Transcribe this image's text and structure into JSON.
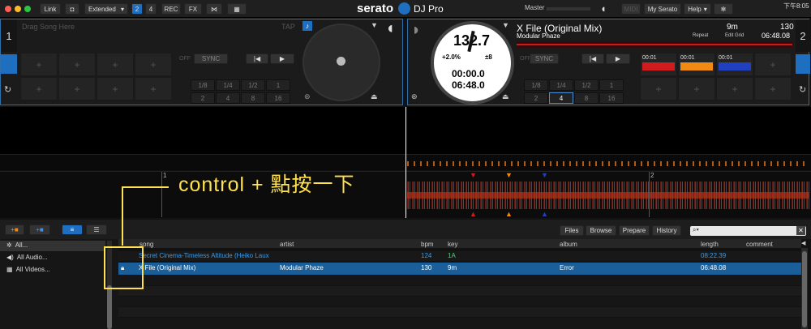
{
  "app": {
    "logo": "serato",
    "logo_suffix": "DJ Pro",
    "master_label": "Master",
    "clock": "下午8:05"
  },
  "toolbar": {
    "link": "Link",
    "mode": "Extended",
    "deck2": "2",
    "deck4": "4",
    "rec": "REC",
    "fx": "FX",
    "midi": "MIDI",
    "my_serato": "My Serato",
    "help": "Help"
  },
  "deck_left": {
    "number": "1",
    "placeholder": "Drag Song Here",
    "tap": "TAP",
    "off": "OFF",
    "sync": "SYNC",
    "beats_row1": [
      "1/8",
      "1/4",
      "1/2",
      "1"
    ],
    "beats_row2": [
      "2",
      "4",
      "8",
      "16"
    ]
  },
  "deck_right": {
    "number": "2",
    "title": "X File (Original Mix)",
    "artist": "Modular Phaze",
    "key": "9m",
    "bpm": "130",
    "repeat": "Repeat",
    "edit_grid": "Edit Grid",
    "total_time": "06:48.08",
    "platter_bpm": "132.7",
    "pitch": "+2.0%",
    "range": "±8",
    "elapsed": "00:00.0",
    "remaining": "06:48.0",
    "off": "OFF",
    "sync": "SYNC",
    "beats_row1": [
      "1/8",
      "1/4",
      "1/2",
      "1"
    ],
    "beats_row2": [
      "2",
      "4",
      "8",
      "16"
    ],
    "cues": [
      "00:01",
      "00:01",
      "00:01"
    ]
  },
  "waveform": {
    "marker1": "1",
    "marker2": "2"
  },
  "annotation": {
    "text": "control + 點按一下"
  },
  "library_tabs": {
    "files": "Files",
    "browse": "Browse",
    "prepare": "Prepare",
    "history": "History"
  },
  "sidebar": {
    "items": [
      "All...",
      "All Audio...",
      "All Videos..."
    ]
  },
  "columns": {
    "song": "song",
    "artist": "artist",
    "bpm": "bpm",
    "key": "key",
    "album": "album",
    "length": "length",
    "comment": "comment"
  },
  "tracks": [
    {
      "song": "Secret Cinema-Timeless Altitude (Heiko Laux",
      "artist": "",
      "bpm": "124",
      "key": "1A",
      "album": "",
      "length": "08:22.39"
    },
    {
      "song": "X File (Original Mix)",
      "artist": "Modular Phaze",
      "bpm": "130",
      "key": "9m",
      "album": "Error",
      "length": "06:48.08"
    }
  ],
  "colors": {
    "accent": "#1e6fc0",
    "selected_row": "#1a5f9a",
    "annotation": "#ffe14d",
    "cue_red": "#d01c1c",
    "cue_orange": "#f08a14",
    "cue_blue": "#2040c0"
  }
}
